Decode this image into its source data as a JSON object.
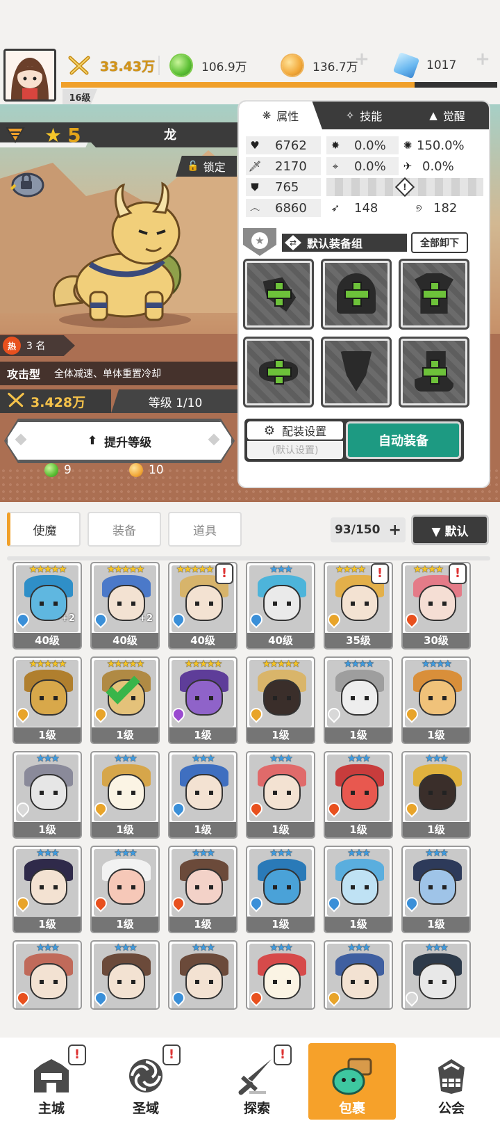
{
  "topbar": {
    "power": "33.43万",
    "green_gem": "106.9万",
    "gold_coin": "136.7万",
    "crystal": "1017",
    "player_level": "16级",
    "exp_fraction": 0.81
  },
  "hero": {
    "star": "5",
    "name": "龙",
    "lock_label": "锁定",
    "hot_rank": "3 名",
    "hot_icon": "热",
    "type": "攻击型",
    "type_desc": "全体减速、单体重置冷却",
    "power": "3.428万",
    "level": "等级 1/10",
    "upgrade_label": "提升等级",
    "cost_green": "9",
    "cost_gold": "10"
  },
  "panel": {
    "tabs": [
      {
        "label": "属性",
        "icon": "attribute-icon",
        "active": true
      },
      {
        "label": "技能",
        "icon": "skill-icon",
        "active": false
      },
      {
        "label": "觉醒",
        "icon": "awaken-icon",
        "active": false
      }
    ],
    "stats": {
      "hp": "6762",
      "attack": "2170",
      "defense": "765",
      "speed": "6860",
      "crit_rate": "0.0%",
      "crit_dmg": "150.0%",
      "accuracy": "0.0%",
      "evasion": "0.0%",
      "stat_a": "148",
      "stat_b": "182"
    },
    "equip_group": "默认装备组",
    "unequip_all": "全部卸下",
    "config_label": "配装设置",
    "config_sub": "(默认设置)",
    "auto_equip": "自动装备"
  },
  "inventory": {
    "tabs": [
      "使魔",
      "装备",
      "道具"
    ],
    "count": "93/150",
    "sort_label": "▼ 默认",
    "cards": [
      {
        "stars": "★★★★★",
        "tier": "gold",
        "level": "40级",
        "plus": "+2",
        "el": "water",
        "color": "#5fb7e0",
        "hat": "#2f8fc8",
        "alert": false
      },
      {
        "stars": "★★★★★",
        "tier": "gold",
        "level": "40级",
        "plus": "+2",
        "el": "water",
        "color": "#f3e2d2",
        "hat": "#4b79c9",
        "alert": false
      },
      {
        "stars": "★★★★★",
        "tier": "gold",
        "level": "40级",
        "plus": "",
        "el": "water",
        "color": "#f3e2d2",
        "hat": "#d7b46b",
        "alert": true
      },
      {
        "stars": "★★★",
        "tier": "blue",
        "level": "40级",
        "plus": "",
        "el": "water",
        "color": "#eaeaea",
        "hat": "#4db4da",
        "alert": false
      },
      {
        "stars": "★★★★",
        "tier": "gold",
        "level": "35级",
        "plus": "",
        "el": "wind",
        "color": "#f3e2d2",
        "hat": "#e3b04a",
        "alert": true
      },
      {
        "stars": "★★★★",
        "tier": "gold",
        "level": "30级",
        "plus": "",
        "el": "fire",
        "color": "#f5ded4",
        "hat": "#e47b88",
        "alert": true
      },
      {
        "stars": "★★★★★",
        "tier": "gold",
        "level": "1级",
        "plus": "",
        "el": "wind",
        "color": "#d8a84a",
        "hat": "#b07f2e",
        "alert": false
      },
      {
        "stars": "★★★★★",
        "tier": "gold",
        "level": "1级",
        "plus": "",
        "el": "wind",
        "color": "#e4c27a",
        "hat": "#b08a44",
        "alert": false,
        "check": true
      },
      {
        "stars": "★★★★★",
        "tier": "gold",
        "level": "1级",
        "plus": "",
        "el": "dark",
        "color": "#8f63c9",
        "hat": "#5e3d99",
        "alert": false
      },
      {
        "stars": "★★★★★",
        "tier": "gold",
        "level": "1级",
        "plus": "",
        "el": "wind",
        "color": "#3a2e2a",
        "hat": "#d9b56a",
        "alert": false
      },
      {
        "stars": "★★★★",
        "tier": "blue",
        "level": "1级",
        "plus": "",
        "el": "light",
        "color": "#eeeeee",
        "hat": "#9e9e9e",
        "alert": false
      },
      {
        "stars": "★★★★",
        "tier": "blue",
        "level": "1级",
        "plus": "",
        "el": "wind",
        "color": "#f0c27a",
        "hat": "#d98f3a",
        "alert": false
      },
      {
        "stars": "★★★",
        "tier": "blue",
        "level": "1级",
        "plus": "",
        "el": "light",
        "color": "#e6e6e6",
        "hat": "#8a8a9a",
        "alert": false
      },
      {
        "stars": "★★★",
        "tier": "blue",
        "level": "1级",
        "plus": "",
        "el": "wind",
        "color": "#fbf4e4",
        "hat": "#d6a64a",
        "alert": false
      },
      {
        "stars": "★★★",
        "tier": "blue",
        "level": "1级",
        "plus": "",
        "el": "water",
        "color": "#f3e2d2",
        "hat": "#3f6fc0",
        "alert": false
      },
      {
        "stars": "★★★",
        "tier": "blue",
        "level": "1级",
        "plus": "",
        "el": "fire",
        "color": "#f3e2d2",
        "hat": "#e06a6a",
        "alert": false
      },
      {
        "stars": "★★★",
        "tier": "blue",
        "level": "1级",
        "plus": "",
        "el": "fire",
        "color": "#e8584f",
        "hat": "#c83c3c",
        "alert": false
      },
      {
        "stars": "★★★",
        "tier": "blue",
        "level": "1级",
        "plus": "",
        "el": "wind",
        "color": "#3a2e2a",
        "hat": "#e0b23e",
        "alert": false
      },
      {
        "stars": "★★★",
        "tier": "blue",
        "level": "1级",
        "plus": "",
        "el": "wind",
        "color": "#f3e2d2",
        "hat": "#2f2a4a",
        "alert": false
      },
      {
        "stars": "★★★",
        "tier": "blue",
        "level": "1级",
        "plus": "",
        "el": "fire",
        "color": "#f6c8b8",
        "hat": "#f2f2f2",
        "alert": false
      },
      {
        "stars": "★★★",
        "tier": "blue",
        "level": "1级",
        "plus": "",
        "el": "fire",
        "color": "#f3d2c8",
        "hat": "#6b4a3a",
        "alert": false
      },
      {
        "stars": "★★★",
        "tier": "blue",
        "level": "1级",
        "plus": "",
        "el": "water",
        "color": "#4aa2d8",
        "hat": "#2a7ab8",
        "alert": false
      },
      {
        "stars": "★★★",
        "tier": "blue",
        "level": "1级",
        "plus": "",
        "el": "water",
        "color": "#bfe2f4",
        "hat": "#5aaede",
        "alert": false
      },
      {
        "stars": "★★★",
        "tier": "blue",
        "level": "1级",
        "plus": "",
        "el": "water",
        "color": "#9fc4e8",
        "hat": "#2d3a5a",
        "alert": false
      },
      {
        "stars": "★★★",
        "tier": "blue",
        "level": "",
        "plus": "",
        "el": "fire",
        "color": "#f3e2d2",
        "hat": "#c06a5a",
        "alert": false
      },
      {
        "stars": "★★★",
        "tier": "blue",
        "level": "",
        "plus": "",
        "el": "water",
        "color": "#f3e2d2",
        "hat": "#6b4a3a",
        "alert": false
      },
      {
        "stars": "★★★",
        "tier": "blue",
        "level": "",
        "plus": "",
        "el": "water",
        "color": "#f3e2d2",
        "hat": "#6b4a3a",
        "alert": false
      },
      {
        "stars": "★★★",
        "tier": "blue",
        "level": "",
        "plus": "",
        "el": "fire",
        "color": "#fbf4e4",
        "hat": "#d64a4a",
        "alert": false
      },
      {
        "stars": "★★★",
        "tier": "blue",
        "level": "",
        "plus": "",
        "el": "wind",
        "color": "#f3e2d2",
        "hat": "#3f5fa0",
        "alert": false
      },
      {
        "stars": "★★★",
        "tier": "blue",
        "level": "",
        "plus": "",
        "el": "light",
        "color": "#e8e8e8",
        "hat": "#2d3a4a",
        "alert": false
      }
    ]
  },
  "nav": [
    {
      "label": "主城",
      "icon": "castle-icon",
      "alert": true,
      "active": false
    },
    {
      "label": "圣域",
      "icon": "vortex-icon",
      "alert": true,
      "active": false
    },
    {
      "label": "探索",
      "icon": "sword-icon",
      "alert": true,
      "active": false
    },
    {
      "label": "包裹",
      "icon": "backpack-icon",
      "alert": false,
      "active": true
    },
    {
      "label": "公会",
      "icon": "guild-icon",
      "alert": false,
      "active": false
    }
  ]
}
